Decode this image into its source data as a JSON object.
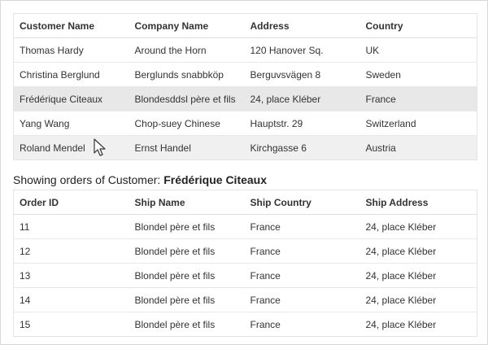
{
  "customers": {
    "columns": [
      "Customer Name",
      "Company Name",
      "Address",
      "Country"
    ],
    "rows": [
      [
        "Thomas Hardy",
        "Around the Horn",
        "120 Hanover Sq.",
        "UK"
      ],
      [
        "Christina Berglund",
        "Berglunds snabbköp",
        "Berguvsvägen 8",
        "Sweden"
      ],
      [
        "Frédérique Citeaux",
        "Blondesddsl père et fils",
        "24, place Kléber",
        "France"
      ],
      [
        "Yang Wang",
        "Chop-suey Chinese",
        "Hauptstr. 29",
        "Switzerland"
      ],
      [
        "Roland Mendel",
        "Ernst Handel",
        "Kirchgasse 6",
        "Austria"
      ]
    ],
    "selected_row_index": 2,
    "hovered_row_index": 4
  },
  "caption": {
    "prefix": "Showing orders of Customer:",
    "customer_name": "Frédérique Citeaux"
  },
  "orders": {
    "columns": [
      "Order ID",
      "Ship Name",
      "Ship Country",
      "Ship Address"
    ],
    "rows": [
      [
        "11",
        "Blondel père et fils",
        "France",
        "24, place Kléber"
      ],
      [
        "12",
        "Blondel père et fils",
        "France",
        "24, place Kléber"
      ],
      [
        "13",
        "Blondel père et fils",
        "France",
        "24, place Kléber"
      ],
      [
        "14",
        "Blondel père et fils",
        "France",
        "24, place Kléber"
      ],
      [
        "15",
        "Blondel père et fils",
        "France",
        "24, place Kléber"
      ]
    ]
  },
  "colors": {
    "selected_row_bg": "#e8e8e8",
    "hovered_row_bg": "#f0f0f0",
    "border": "#e3e3e3",
    "text": "#333333"
  },
  "icons": {
    "pointer": "mouse-pointer-icon"
  }
}
